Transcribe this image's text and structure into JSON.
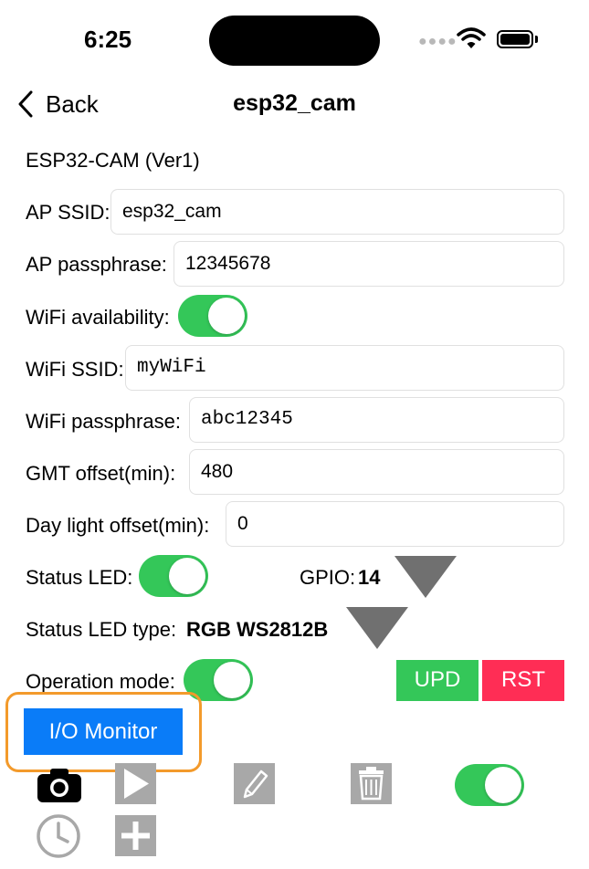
{
  "status_bar": {
    "time": "6:25"
  },
  "nav": {
    "back_label": "Back",
    "title": "esp32_cam"
  },
  "device": {
    "title": "ESP32-CAM (Ver1)"
  },
  "form": {
    "ap_ssid": {
      "label": "AP SSID:",
      "value": "esp32_cam"
    },
    "ap_passphrase": {
      "label": "AP passphrase:",
      "value": "12345678"
    },
    "wifi_availability": {
      "label": "WiFi availability:",
      "on": true
    },
    "wifi_ssid": {
      "label": "WiFi SSID:",
      "value": "myWiFi"
    },
    "wifi_passphrase": {
      "label": "WiFi passphrase:",
      "value": "abc12345"
    },
    "gmt_offset": {
      "label": "GMT offset(min):",
      "value": "480"
    },
    "daylight_offset": {
      "label": "Day light offset(min):",
      "value": "0"
    },
    "status_led": {
      "label": "Status LED:",
      "on": true
    },
    "gpio": {
      "label": "GPIO:",
      "value": "14"
    },
    "status_led_type": {
      "label": "Status LED type:",
      "value": "RGB WS2812B"
    },
    "operation_mode": {
      "label": "Operation mode:",
      "on": true
    }
  },
  "buttons": {
    "upd": "UPD",
    "rst": "RST",
    "io_monitor": "I/O Monitor"
  },
  "toolbar": {
    "items": [
      "camera-icon",
      "play-icon",
      "pencil-icon",
      "trash-icon",
      "toggle",
      "clock-icon",
      "plus-icon"
    ]
  },
  "colors": {
    "toggle_on": "#34c759",
    "upd": "#34c759",
    "rst": "#ff2d55",
    "io_monitor": "#0a7cf8",
    "highlight": "#f39a2b"
  }
}
